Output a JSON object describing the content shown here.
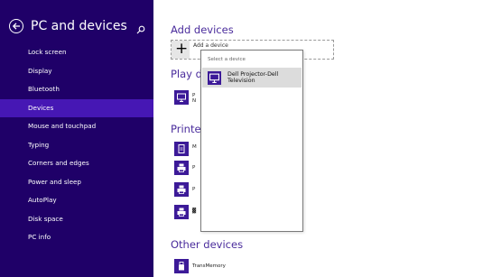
{
  "sidebar": {
    "title": "PC and devices",
    "items": [
      "Lock screen",
      "Display",
      "Bluetooth",
      "Devices",
      "Mouse and touchpad",
      "Typing",
      "Corners and edges",
      "Power and sleep",
      "AutoPlay",
      "Disk space",
      "PC info"
    ],
    "selected": "Devices"
  },
  "main": {
    "add_devices_title": "Add devices",
    "add_device_label": "Add a device",
    "play_title": "Play de",
    "play_device": {
      "line1": "P",
      "line2": "N"
    },
    "printers_title": "Printer",
    "printers": [
      "M",
      "P",
      "P",
      "▓"
    ],
    "other_title": "Other devices",
    "other_device": "TransMemory"
  },
  "popup": {
    "header": "Select a device",
    "item_line1": "Dell Projector-Dell",
    "item_line2": "Television"
  },
  "colors": {
    "sidebar_bg": "#1f0068",
    "selected_bg": "#4617b4",
    "accent": "#4a2c9c",
    "icon_bg": "#3c1a98"
  }
}
